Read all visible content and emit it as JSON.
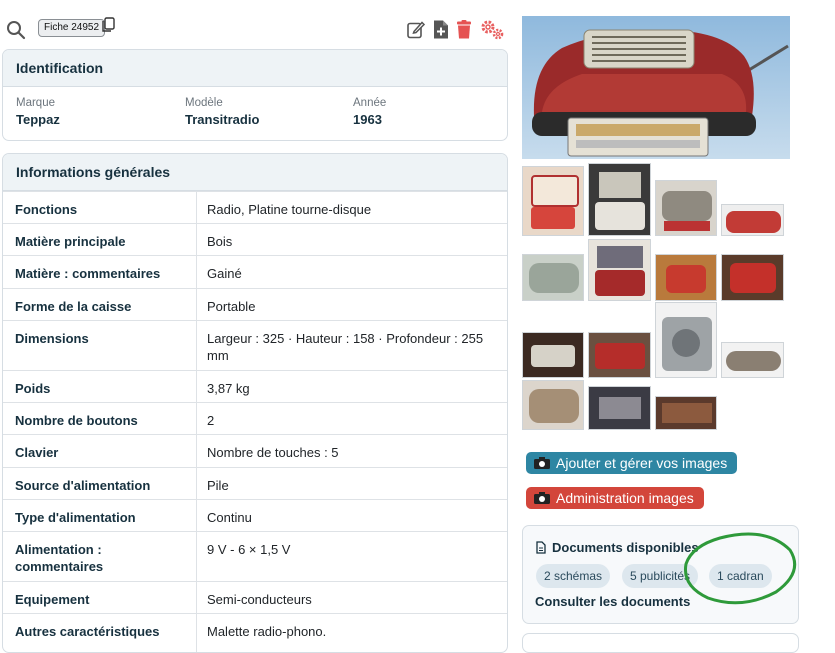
{
  "toolbar": {
    "fiche_label": "Fiche 24952",
    "icons": [
      "search-icon",
      "copy-icon",
      "edit-icon",
      "add-file-icon",
      "trash-icon",
      "settings-icon"
    ]
  },
  "identification": {
    "title": "Identification",
    "fields": [
      {
        "label": "Marque",
        "value": "Teppaz"
      },
      {
        "label": "Modèle",
        "value": "Transitradio"
      },
      {
        "label": "Année",
        "value": "1963"
      }
    ]
  },
  "general_info": {
    "title": "Informations générales",
    "rows": [
      {
        "key": "Fonctions",
        "value": "Radio, Platine tourne-disque"
      },
      {
        "key": "Matière principale",
        "value": "Bois"
      },
      {
        "key": "Matière : commentaires",
        "value": "Gainé"
      },
      {
        "key": "Forme de la caisse",
        "value": "Portable"
      },
      {
        "key": "Dimensions",
        "value": "Largeur : 325 · Hauteur : 158 · Profondeur : 255 mm"
      },
      {
        "key": "Poids",
        "value": "3,87 kg"
      },
      {
        "key": "Nombre de boutons",
        "value": "2"
      },
      {
        "key": "Clavier",
        "value": "Nombre de touches : 5"
      },
      {
        "key": "Source d'alimentation",
        "value": "Pile"
      },
      {
        "key": "Type d'alimentation",
        "value": "Continu"
      },
      {
        "key": "Alimentation : commentaires",
        "value": "9 V - 6 × 1,5 V"
      },
      {
        "key": "Equipement",
        "value": "Semi-conducteurs"
      },
      {
        "key": "Autres caractéristiques",
        "value": "Malette radio-phono."
      }
    ]
  },
  "images": {
    "add_button_label": "Ajouter et gérer vos images",
    "admin_button_label": "Administration images"
  },
  "documents": {
    "title": "Documents disponibles",
    "pills": [
      "2 schémas",
      "5 publicités",
      "1 cadran"
    ],
    "link_label": "Consulter les documents",
    "annotation_color": "#2e9a3a"
  },
  "colors": {
    "accent_blue": "#2e86a3",
    "accent_red": "#d3463b",
    "header_bg": "#eef3f6"
  }
}
